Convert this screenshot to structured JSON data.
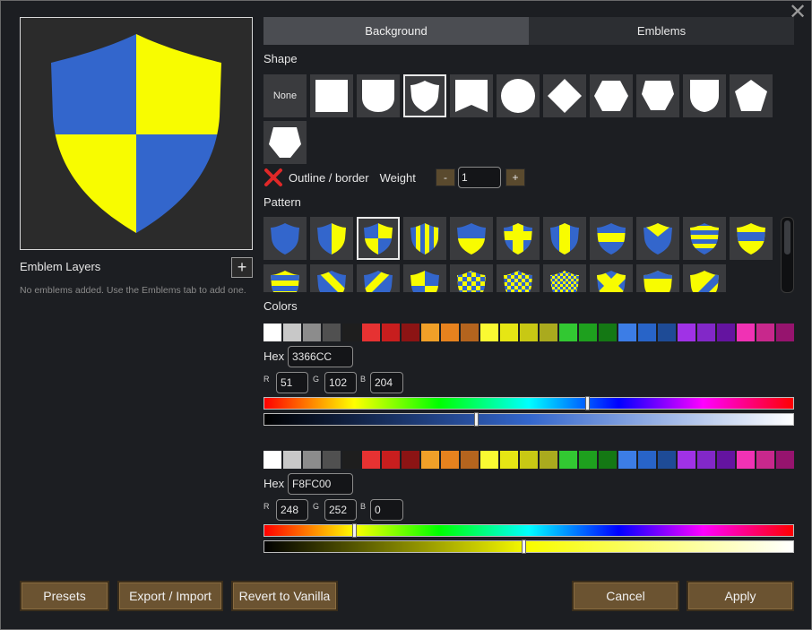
{
  "window": {
    "close_glyph": "✕"
  },
  "tabs": [
    {
      "label": "Background",
      "active": true
    },
    {
      "label": "Emblems",
      "active": false
    }
  ],
  "preview": {
    "icon": "shield-quartered-icon",
    "colors": [
      "#3366CC",
      "#F8FC00"
    ]
  },
  "layers": {
    "title": "Emblem Layers",
    "add_glyph": "+",
    "empty_text": "No emblems added. Use the Emblems tab to add one."
  },
  "shape": {
    "label": "Shape",
    "none_label": "None",
    "items": [
      "none",
      "square",
      "heater-shield",
      "kite-shield",
      "banner",
      "circle",
      "diamond",
      "hexagon",
      "rounded-hexagon",
      "round-shield",
      "pentagon",
      "house-pentagon"
    ],
    "selected": "kite-shield"
  },
  "outline": {
    "label": "Outline / border",
    "enabled": false,
    "weight_label": "Weight",
    "minus": "-",
    "plus": "+",
    "weight": "1"
  },
  "pattern": {
    "label": "Pattern",
    "selected_index": 2,
    "items": [
      "solid",
      "per-pale",
      "quarterly",
      "paly",
      "per-fess",
      "cross",
      "pale",
      "fess",
      "chevron-point",
      "barry",
      "fess-wide",
      "barry-2",
      "bend",
      "bend-sinister",
      "quarterly-2",
      "checky-small",
      "checky-diamond",
      "checky-fine",
      "saltire",
      "fess-2",
      "bend-3"
    ]
  },
  "colors": {
    "label": "Colors",
    "palette": [
      "#FFFFFF",
      "#C8C8C8",
      "#8C8C8C",
      "#505050",
      "#1E1E1E",
      "#E63232",
      "#C81E1E",
      "#8C1414",
      "#F0A028",
      "#E6821E",
      "#B4641E",
      "#FAFA32",
      "#E6E614",
      "#C8C814",
      "#AAAA1E",
      "#32C832",
      "#1EA01E",
      "#147814",
      "#3C7DE6",
      "#2864C8",
      "#1E4B96",
      "#A032E6",
      "#8228C8",
      "#6414A0",
      "#F032B4",
      "#C8288C",
      "#96146E"
    ],
    "primary": {
      "selected_hex": "#3366CC",
      "hex_label": "Hex",
      "hex": "3366CC",
      "r_label": "R",
      "g_label": "G",
      "b_label": "B",
      "r": "51",
      "g": "102",
      "b": "204",
      "hue_fraction": 0.61,
      "value_fraction": 0.4
    },
    "secondary": {
      "selected_hex": "#F8FC00",
      "hex_label": "Hex",
      "hex": "F8FC00",
      "r_label": "R",
      "g_label": "G",
      "b_label": "B",
      "r": "248",
      "g": "252",
      "b": "0",
      "hue_fraction": 0.17,
      "value_fraction": 0.49
    }
  },
  "buttons": {
    "presets": "Presets",
    "export_import": "Export / Import",
    "revert": "Revert to Vanilla",
    "cancel": "Cancel",
    "apply": "Apply"
  }
}
